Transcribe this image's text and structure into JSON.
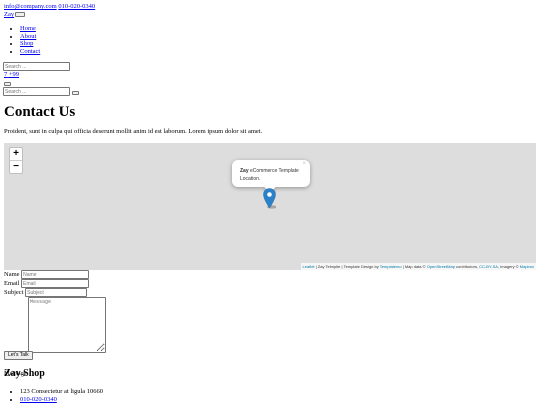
{
  "topbar": {
    "email": "info@company.com",
    "phone": "010-020-0340"
  },
  "brand": {
    "name": "Zay"
  },
  "nav": {
    "items": [
      {
        "label": "Home"
      },
      {
        "label": "About"
      },
      {
        "label": "Shop"
      },
      {
        "label": "Contact"
      }
    ]
  },
  "search": {
    "placeholder": "Search ..."
  },
  "cart": {
    "text": "7",
    "badge": "+99"
  },
  "modal_search": {
    "placeholder": "Search ..."
  },
  "page": {
    "title": "Contact Us",
    "intro": "Proident, sunt in culpa qui officia deserunt mollit anim id est laborum. Lorem ipsum dolor sit amet."
  },
  "map": {
    "zoom_in": "+",
    "zoom_out": "−",
    "popup_title": "Zay",
    "popup_text": " eCommerce Template Location.",
    "popup_close": "×",
    "attribution": {
      "leaflet": "Leaflet",
      "text1": " | Zay Telmplte | Template Design by ",
      "templatemo": "Templatemo",
      "text2": " | Map data © ",
      "osm": "OpenStreetMap",
      "text3": " contributors, ",
      "ccbysa": "CC-BY-SA",
      "text4": ", Imagery © ",
      "mapbox": "Mapbox"
    },
    "marker_color": "#2a81cb"
  },
  "form": {
    "name_label": "Name",
    "name_placeholder": "Name",
    "email_label": "Email",
    "email_placeholder": "Email",
    "subject_label": "Subject",
    "subject_placeholder": "Subject",
    "message_label": "Message",
    "message_placeholder": "Message",
    "submit_label": "Let’s Talk"
  },
  "footer": {
    "title": "Zay Shop",
    "items": [
      {
        "text": "123 Consectetur at ligula 10660"
      },
      {
        "text": "010-020-0340"
      }
    ]
  }
}
